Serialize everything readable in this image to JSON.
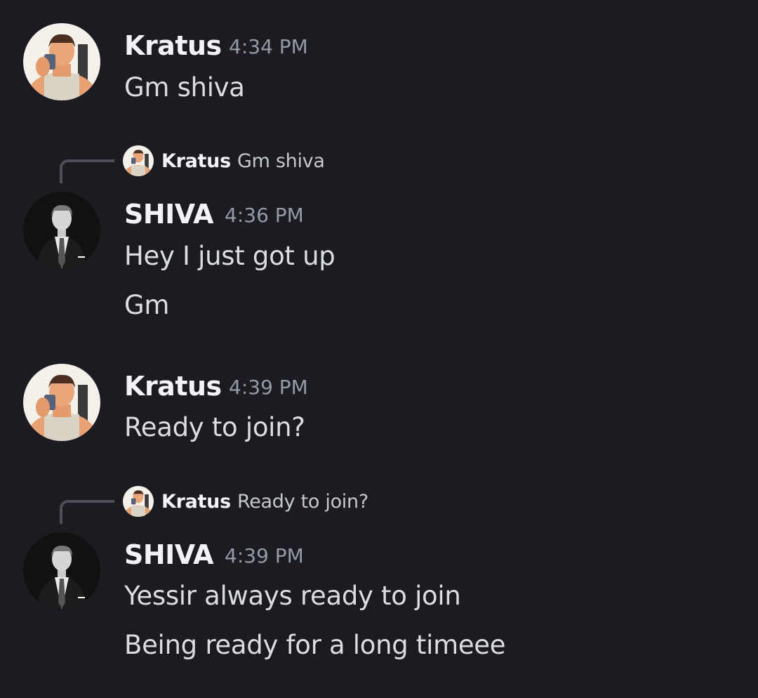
{
  "colors": {
    "background": "#1b1b21",
    "author": "#f2f3f5",
    "message": "#dbdee1",
    "timestamp": "#949ba4",
    "reply_line": "#4e5058"
  },
  "messages": [
    {
      "author": "Kratus",
      "time": "4:34 PM",
      "avatar_icon": "muscular-man-selfie-avatar",
      "lines": [
        "Gm shiva"
      ]
    },
    {
      "author": "SHIVA",
      "time": "4:36 PM",
      "avatar_icon": "man-in-suit-avatar",
      "reply": {
        "author": "Kratus",
        "text": "Gm shiva"
      },
      "lines": [
        "Hey I just got up",
        "Gm"
      ]
    },
    {
      "author": "Kratus",
      "time": "4:39 PM",
      "avatar_icon": "muscular-man-selfie-avatar",
      "lines": [
        "Ready to join?"
      ]
    },
    {
      "author": "SHIVA",
      "time": "4:39 PM",
      "avatar_icon": "man-in-suit-avatar",
      "reply": {
        "author": "Kratus",
        "text": "Ready to join?"
      },
      "lines": [
        "Yessir always ready to join",
        "Being ready for a long timeee"
      ]
    }
  ]
}
